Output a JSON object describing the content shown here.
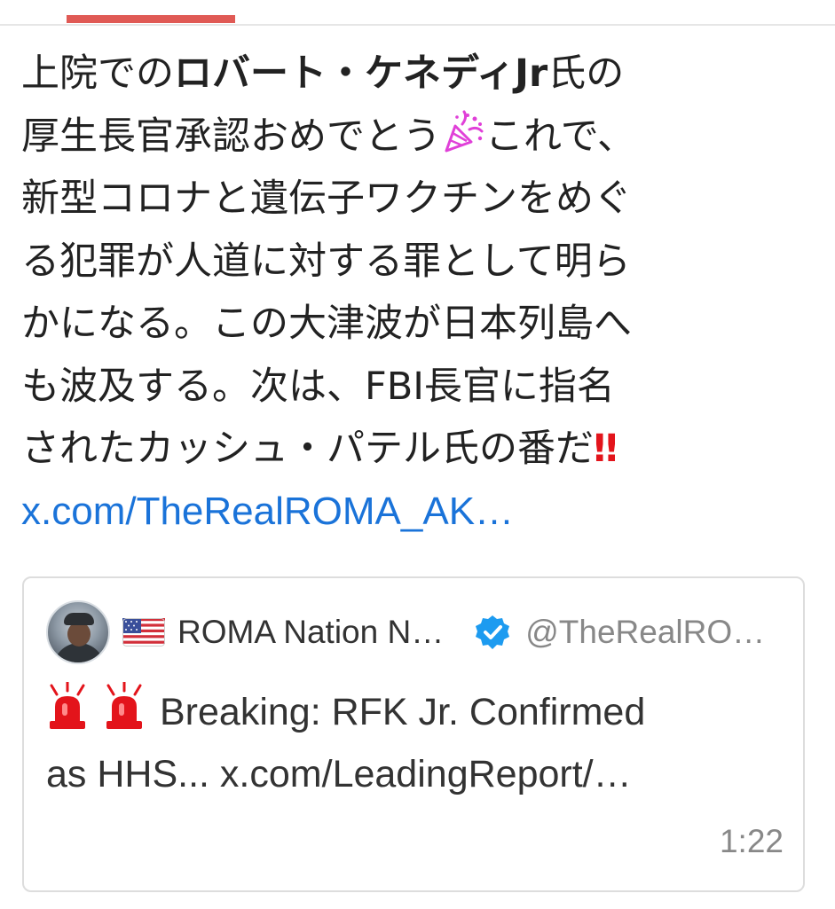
{
  "post": {
    "lines": [
      {
        "pre": "上院での",
        "bold": "ロバート・ケネディJr",
        "post": "氏の"
      },
      {
        "text": "厚生長官承認おめでとう",
        "after_emoji": "これで、"
      },
      {
        "text": "新型コロナと遺伝子ワクチンをめぐ"
      },
      {
        "text": "る犯罪が人道に対する罪として明ら"
      },
      {
        "text": "かになる。この大津波が日本列島へ"
      },
      {
        "text": "も波及する。次は、FBI長官に指名"
      },
      {
        "text": "されたカッシュ・パテル氏の番だ",
        "emoji_bang": "‼"
      }
    ],
    "link": "x.com/TheRealROMA_AK…",
    "party_emoji": "party-popper-icon"
  },
  "quote": {
    "flag": "🇺🇸",
    "display_name": "ROMA Nation N…",
    "handle": "@TheRealRO…",
    "text_line1": "Breaking: RFK Jr. Confirmed",
    "text_line2": "as HHS... x.com/LeadingReport/…",
    "time": "1:22"
  },
  "colors": {
    "accent": "#e05a55",
    "link": "#1a73d9",
    "verified": "#1d9bf0",
    "siren": "#e3141b",
    "party": "#e040d8"
  }
}
